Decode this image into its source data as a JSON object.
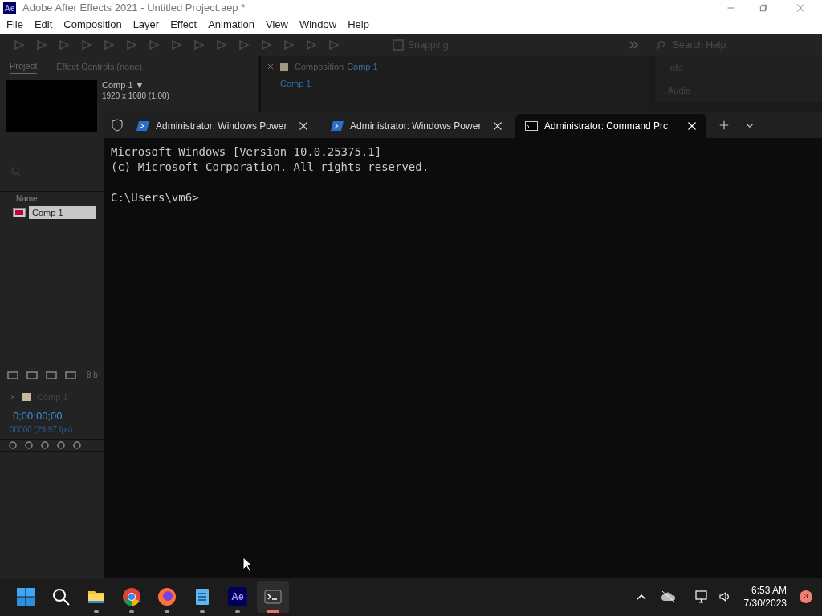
{
  "ae": {
    "title": "Adobe After Effects 2021 - Untitled Project.aep *",
    "logo": "Ae",
    "menu": [
      "File",
      "Edit",
      "Composition",
      "Layer",
      "Effect",
      "Animation",
      "View",
      "Window",
      "Help"
    ],
    "snapping": {
      "label": "Snapping",
      "checked": false
    },
    "search": {
      "placeholder": "Search Help"
    },
    "project_tabs": [
      {
        "label": "Project",
        "selected": true
      },
      {
        "label": "Effect Controls (none)",
        "selected": false
      }
    ],
    "item": {
      "name": "Comp 1 ▼",
      "size": "1920 x 1080 (1.00)"
    },
    "column": "Name",
    "rows": [
      {
        "name": "Comp 1",
        "selected": true
      }
    ],
    "bpc": "8 b",
    "timeline": {
      "tab": "Comp 1",
      "timecode": "0;00;00;00",
      "frames": "00000 (29.97 fps)"
    },
    "composition": {
      "label": "Composition",
      "name": "Comp 1",
      "subtab": "Comp 1"
    },
    "right_panels": [
      "Info",
      "Audio"
    ]
  },
  "terminal": {
    "tabs": [
      {
        "kind": "powershell",
        "title": "Administrator: Windows Power",
        "selected": false
      },
      {
        "kind": "powershell",
        "title": "Administrator: Windows Power",
        "selected": false
      },
      {
        "kind": "cmd",
        "title": "Administrator:  Command Prc",
        "selected": true
      }
    ],
    "blocks": [
      [
        "Microsoft Windows [Version 10.0.25375.1]",
        "(c) Microsoft Corporation. All rights reserved."
      ],
      [
        "C:\\Users\\vm6>"
      ]
    ]
  },
  "taskbar": {
    "apps": [
      {
        "kind": "start",
        "running": false,
        "active": false
      },
      {
        "kind": "search",
        "running": false,
        "active": false
      },
      {
        "kind": "folder",
        "running": true,
        "active": false
      },
      {
        "kind": "chrome",
        "running": true,
        "active": false
      },
      {
        "kind": "firefox",
        "running": true,
        "active": false
      },
      {
        "kind": "notepad",
        "running": true,
        "active": false
      },
      {
        "kind": "ae",
        "running": true,
        "active": false,
        "label": "Ae"
      },
      {
        "kind": "terminal",
        "running": true,
        "active": true
      }
    ],
    "time": "6:53 AM",
    "date": "7/30/2023",
    "badge": "3"
  }
}
